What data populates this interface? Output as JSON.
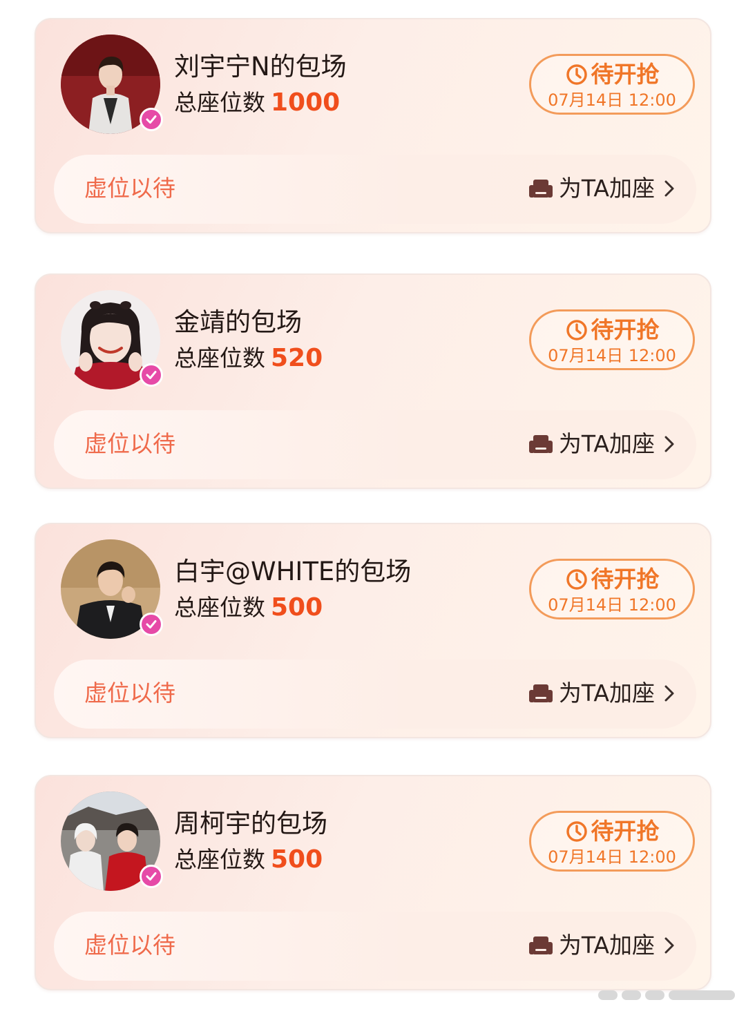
{
  "cards": [
    {
      "title": "刘宇宁N的包场",
      "seats_label": "总座位数",
      "seats_count": "1000",
      "status": "待开抢",
      "time": "07月14日 12:00",
      "waiting": "虚位以待",
      "add_seat": "为TA加座",
      "avatar_icon": "avatar-liu-yuning"
    },
    {
      "title": "金靖的包场",
      "seats_label": "总座位数",
      "seats_count": "520",
      "status": "待开抢",
      "time": "07月14日 12:00",
      "waiting": "虚位以待",
      "add_seat": "为TA加座",
      "avatar_icon": "avatar-jin-jing"
    },
    {
      "title": "白宇@WHITE的包场",
      "seats_label": "总座位数",
      "seats_count": "500",
      "status": "待开抢",
      "time": "07月14日 12:00",
      "waiting": "虚位以待",
      "add_seat": "为TA加座",
      "avatar_icon": "avatar-bai-yu"
    },
    {
      "title": "周柯宇的包场",
      "seats_label": "总座位数",
      "seats_count": "500",
      "status": "待开抢",
      "time": "07月14日 12:00",
      "waiting": "虚位以待",
      "add_seat": "为TA加座",
      "avatar_icon": "avatar-zhou-keyu"
    }
  ],
  "colors": {
    "accent_orange": "#f07628",
    "seat_count_red": "#f04e1c",
    "waiting_text": "#ef6a4b",
    "verified_badge": "#e64aa7"
  }
}
